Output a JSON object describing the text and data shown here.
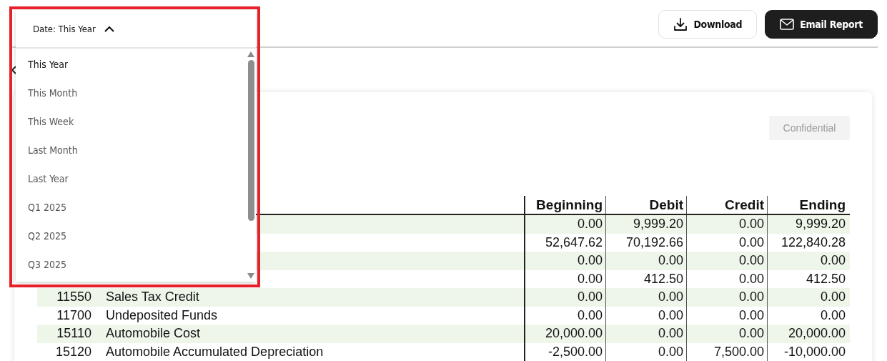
{
  "date_filter": {
    "label": "Date:",
    "value": "This Year",
    "expanded": true,
    "options": [
      {
        "label": "This Year",
        "selected": true
      },
      {
        "label": "This Month",
        "selected": false
      },
      {
        "label": "This Week",
        "selected": false
      },
      {
        "label": "Last Month",
        "selected": false
      },
      {
        "label": "Last Year",
        "selected": false
      },
      {
        "label": "Q1 2025",
        "selected": false
      },
      {
        "label": "Q2 2025",
        "selected": false
      },
      {
        "label": "Q3 2025",
        "selected": false
      }
    ]
  },
  "actions": [
    {
      "kind": "download",
      "label": "Download"
    },
    {
      "kind": "email",
      "label": "Email Report"
    }
  ],
  "badge": "Confidential",
  "table": {
    "columns": [
      "Beginning",
      "Debit",
      "Credit",
      "Ending"
    ],
    "rows": [
      {
        "values": [
          "0.00",
          "9,999.20",
          "0.00",
          "9,999.20"
        ]
      },
      {
        "values": [
          "52,647.62",
          "70,192.66",
          "0.00",
          "122,840.28"
        ]
      },
      {
        "values": [
          "0.00",
          "0.00",
          "0.00",
          "0.00"
        ]
      },
      {
        "values": [
          "0.00",
          "412.50",
          "0.00",
          "412.50"
        ]
      },
      {
        "code": "11550",
        "name": "Sales Tax Credit",
        "values": [
          "0.00",
          "0.00",
          "0.00",
          "0.00"
        ]
      },
      {
        "code": "11700",
        "name": "Undeposited Funds",
        "values": [
          "0.00",
          "0.00",
          "0.00",
          "0.00"
        ]
      },
      {
        "code": "15110",
        "name": "Automobile Cost",
        "values": [
          "20,000.00",
          "0.00",
          "0.00",
          "20,000.00"
        ]
      },
      {
        "code": "15120",
        "name": "Automobile Accumulated Depreciation",
        "values": [
          "-2,500.00",
          "0.00",
          "7,500.00",
          "-10,000.00"
        ]
      }
    ]
  }
}
